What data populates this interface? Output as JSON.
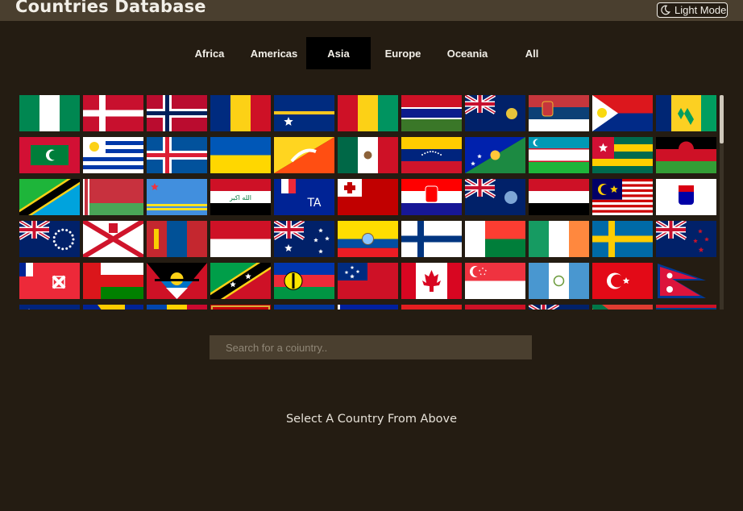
{
  "header": {
    "title": "Countries Database",
    "mode_label": "Light Mode",
    "mode_icon": "moon-icon"
  },
  "tabs": [
    {
      "label": "Africa",
      "active": false
    },
    {
      "label": "Americas",
      "active": false
    },
    {
      "label": "Asia",
      "active": true
    },
    {
      "label": "Europe",
      "active": false
    },
    {
      "label": "Oceania",
      "active": false
    },
    {
      "label": "All",
      "active": false
    }
  ],
  "flags": [
    [
      "nigeria",
      "denmark",
      "norway",
      "romania",
      "nauru",
      "guinea",
      "gambia",
      "turks-and-caicos",
      "serbia",
      "sint-maarten",
      "saint-vincent"
    ],
    [
      "maldives",
      "uruguay",
      "iceland",
      "ukraine",
      "bhutan",
      "mexico",
      "venezuela",
      "christmas-island",
      "uzbekistan",
      "togo",
      "malawi"
    ],
    [
      "tanzania",
      "belarus",
      "aruba",
      "iraq",
      "french-southern-territories",
      "tonga",
      "croatia",
      "south-georgia",
      "yemen",
      "malaysia",
      "saint-barthelemy"
    ],
    [
      "cook-islands",
      "jersey",
      "mongolia",
      "indonesia",
      "heard-island",
      "ecuador",
      "finland",
      "madagascar",
      "ireland",
      "sweden",
      "new-zealand"
    ],
    [
      "wallis-and-futuna",
      "oman",
      "antigua-and-barbuda",
      "saint-kitts-and-nevis",
      "new-caledonia",
      "samoa",
      "canada",
      "singapore",
      "guatemala",
      "turkey",
      "nepal"
    ],
    [
      "tokelau",
      "bosnia",
      "moldova",
      "montenegro",
      "eu",
      "haiti",
      "albania",
      "grenada",
      "virgin-islands",
      "south-africa",
      "belize"
    ]
  ],
  "search": {
    "placeholder": "Search for a coiuntry.."
  },
  "prompt": "Select A Country From Above"
}
